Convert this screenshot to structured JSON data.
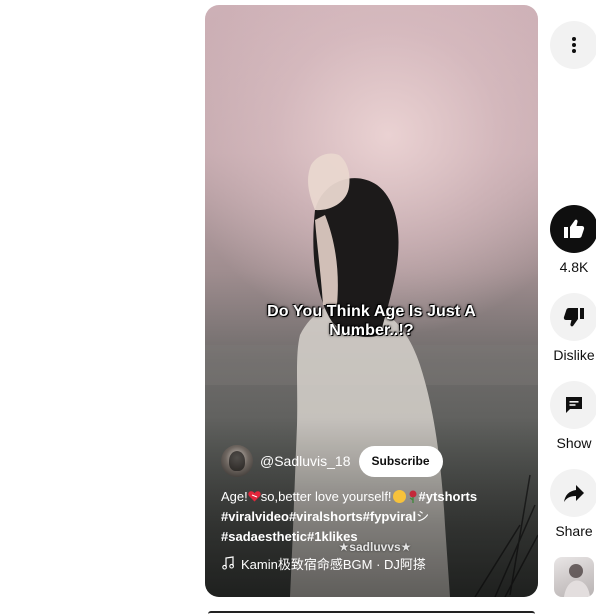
{
  "video": {
    "overlay_text": "Do You Think Age Is Just A Number..!?",
    "watermark": "★sadluvvs★",
    "channel": {
      "handle": "@Sadluvis_18",
      "subscribe_label": "Subscribe"
    },
    "description": {
      "prefix_1": "Age!",
      "prefix_2": "so,better love yourself!",
      "tag_1": "#ytshorts",
      "tag_2": "#viralvideo",
      "tag_3": "#viralshorts",
      "tag_4": "#fypviral",
      "suffix_symbol": "シ",
      "tag_5": "#sadaesthetic",
      "tag_6": "#1klikes"
    },
    "music": "Kamin极致宿命感BGM · DJ阿搽"
  },
  "rail": {
    "like_count": "4.8K",
    "dislike_label": "Dislike",
    "comments_label": "Show",
    "share_label": "Share"
  },
  "icons": {
    "more": "more-vert-icon",
    "like": "thumbs-up-icon",
    "dislike": "thumbs-down-icon",
    "comments": "comment-icon",
    "share": "share-arrow-icon",
    "music": "music-note-icon"
  },
  "colors": {
    "like_button_bg": "#0f0f0f",
    "rail_button_bg": "#f2f2f2",
    "subscribe_bg": "#ffffff"
  }
}
